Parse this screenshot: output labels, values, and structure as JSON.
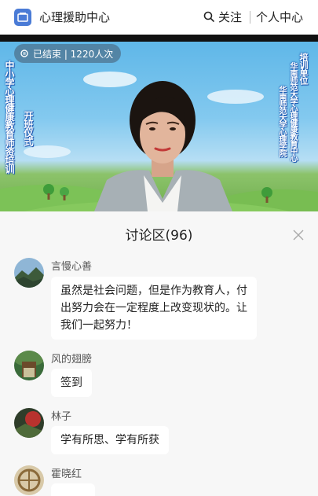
{
  "header": {
    "title": "心理援助中心",
    "follow_label": "关注",
    "personal_label": "个人中心",
    "icons": {
      "logo": "app-logo-icon",
      "search": "search-icon"
    }
  },
  "video": {
    "status_text": "已结束 | 1220人次",
    "left_banner": "中小学心理健康教育师资培训",
    "left_banner_sub": "开班仪式",
    "right_banner_line1": "培训单位",
    "right_banner_line2": "华南师范大学心理健康教育中心",
    "right_banner_line3": "华南师范大学心理学院"
  },
  "discussion": {
    "title": "讨论区(96)",
    "messages": [
      {
        "name": "言慢心善",
        "text": "虽然是社会问题，但是作为教育人，付出努力会在一定程度上改变现状的。让我们一起努力！"
      },
      {
        "name": "风的翅膀",
        "text": "签到"
      },
      {
        "name": "林子",
        "text": "学有所思、学有所获"
      },
      {
        "name": "霍晓红",
        "text": ""
      }
    ]
  },
  "colors": {
    "accent": "#4a7bd6",
    "panel_bg": "#f7f7f7",
    "bubble_bg": "#ffffff"
  }
}
